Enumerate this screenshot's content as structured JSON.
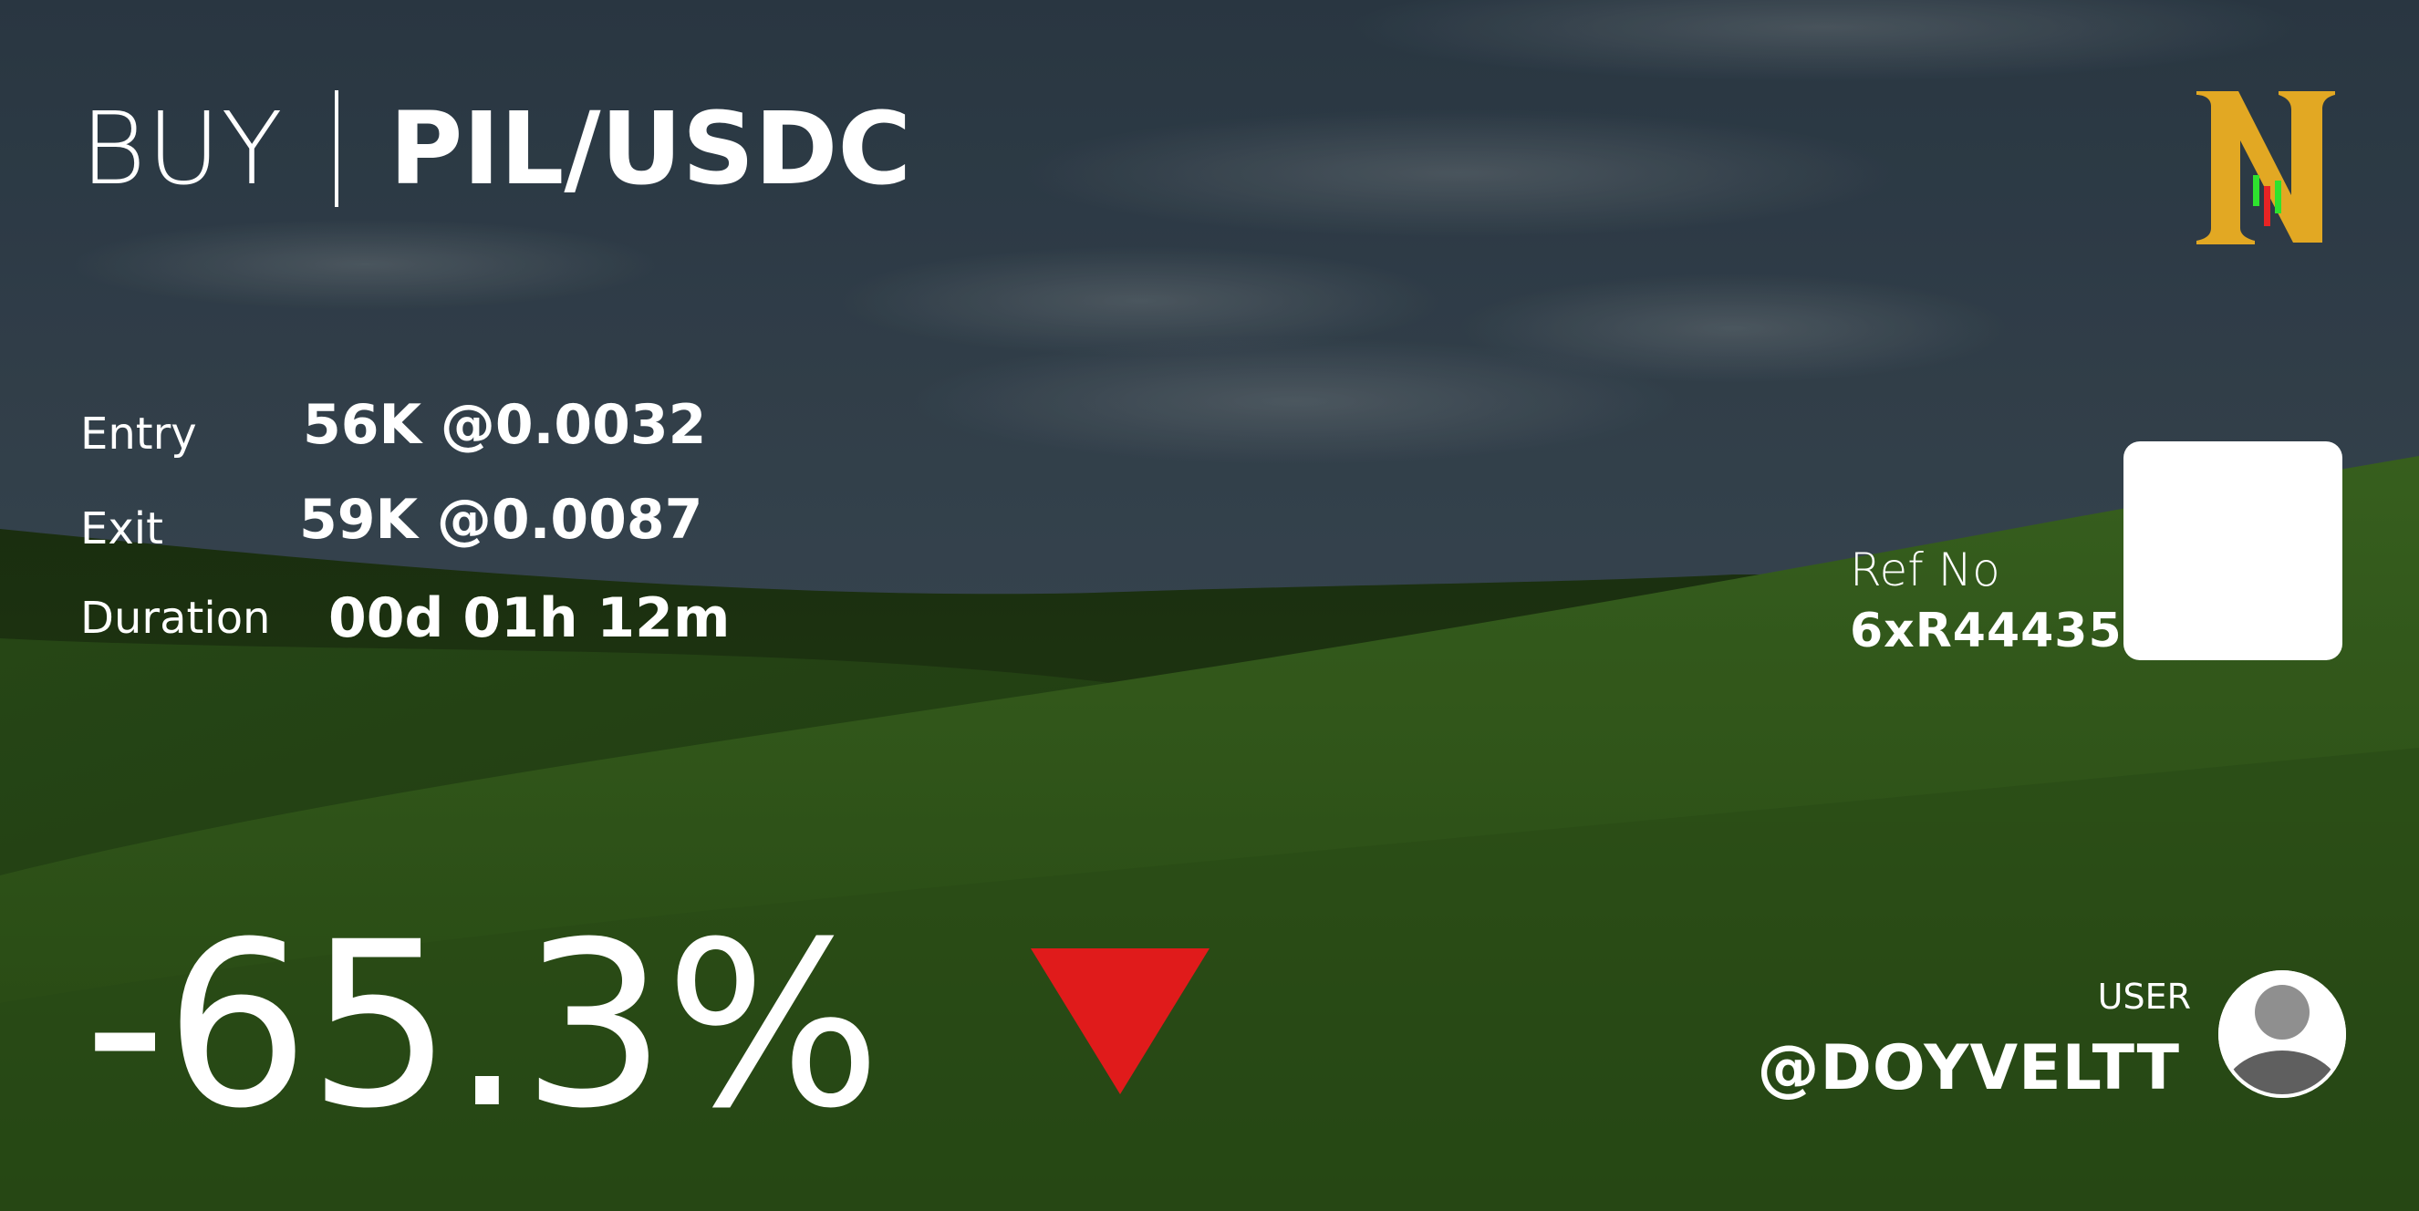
{
  "trade": {
    "side": "BUY",
    "pair": "PIL/USDC"
  },
  "stats": {
    "entry_label": "Entry",
    "entry_value": "56K @0.0032",
    "exit_label": "Exit",
    "exit_value": "59K @0.0087",
    "duration_label": "Duration",
    "duration_value": "00d 01h 12m"
  },
  "reference": {
    "label": "Ref No",
    "value": "6xR44435"
  },
  "result": {
    "pnl_percent": "-65.3%",
    "direction": "down",
    "direction_icon": "down-triangle-icon"
  },
  "user": {
    "label": "USER",
    "handle": "@DOYVELTT",
    "avatar_icon": "user-avatar-icon"
  },
  "brand": {
    "logo_icon": "n-logo-icon"
  },
  "colors": {
    "accent_gold": "#e2a823",
    "loss_red": "#e01b1b",
    "candle_green": "#2ee32e",
    "candle_red": "#e82424",
    "text": "#ffffff",
    "qr_placeholder": "#ffffff"
  }
}
